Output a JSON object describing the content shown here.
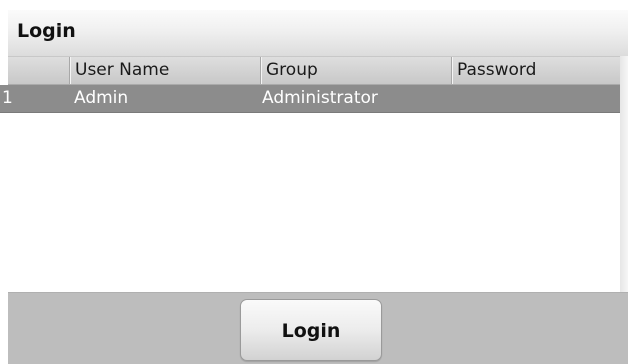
{
  "screen": {
    "title": "Login"
  },
  "table": {
    "columns": [
      "",
      "User Name",
      "Group",
      "Password"
    ],
    "rows": [
      {
        "index": "1",
        "user_name": "Admin",
        "group": "Administrator",
        "password": ""
      }
    ]
  },
  "footer": {
    "login_label": "Login"
  },
  "colors": {
    "selected_row": "#8c8c8c",
    "footer_bar": "#bdbdbd"
  }
}
